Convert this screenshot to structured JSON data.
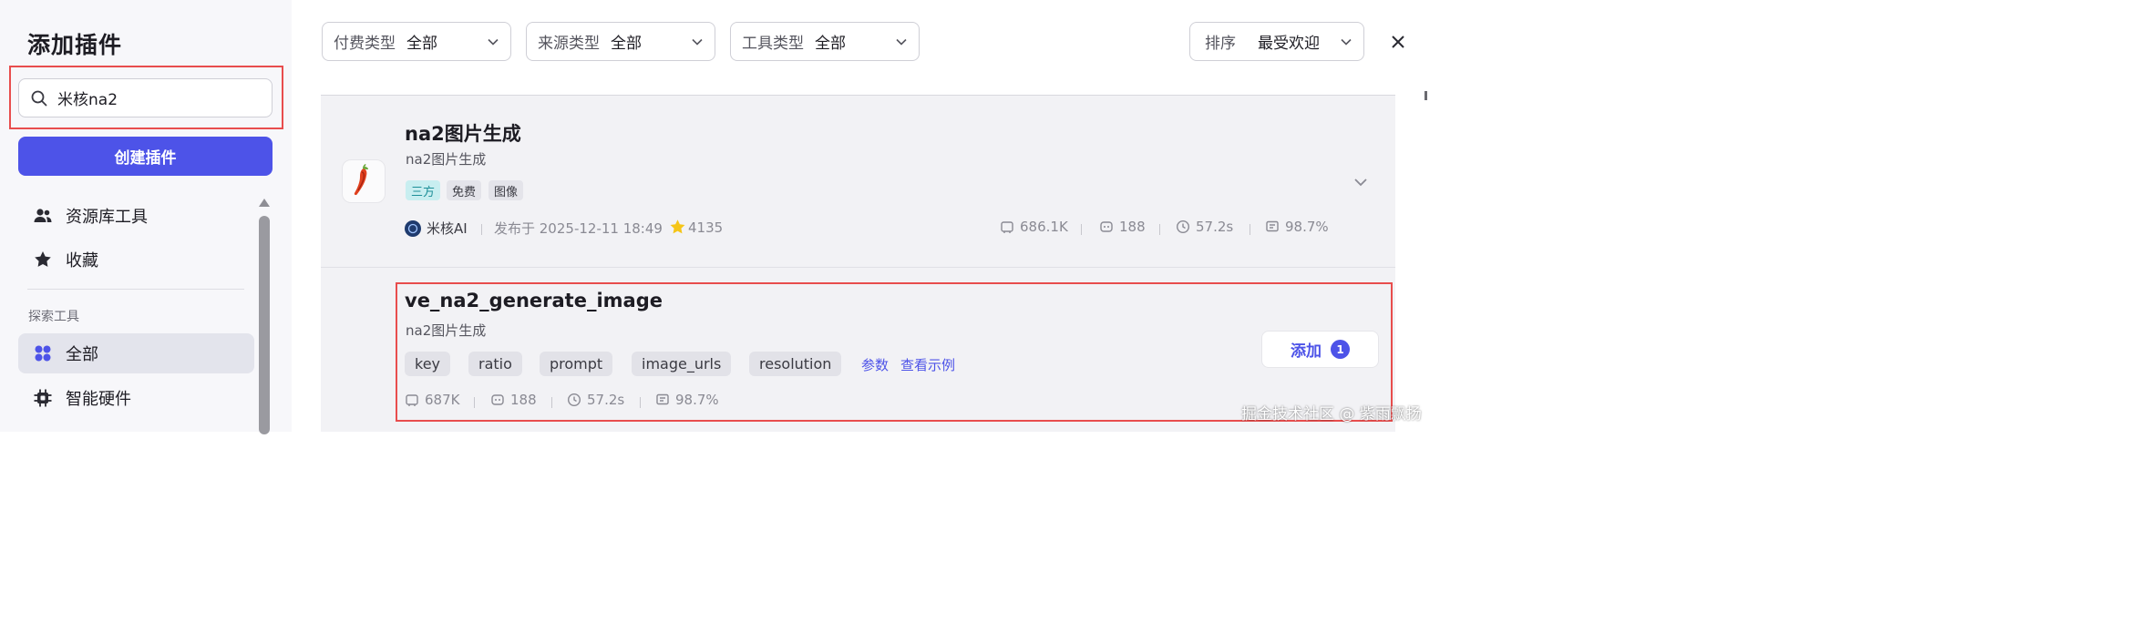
{
  "sidebar": {
    "title": "添加插件",
    "search": {
      "value": "米核na2",
      "placeholder": ""
    },
    "create_label": "创建插件",
    "items": [
      {
        "label": "资源库工具",
        "icon": "users-icon"
      },
      {
        "label": "收藏",
        "icon": "star-icon"
      }
    ],
    "section_label": "探索工具",
    "explore_items": [
      {
        "label": "全部",
        "icon": "grid-icon",
        "active": true
      },
      {
        "label": "智能硬件",
        "icon": "chip-icon"
      }
    ]
  },
  "filters": [
    {
      "label": "付费类型",
      "value": "全部"
    },
    {
      "label": "来源类型",
      "value": "全部"
    },
    {
      "label": "工具类型",
      "value": "全部"
    }
  ],
  "sort": {
    "label": "排序",
    "value": "最受欢迎"
  },
  "plugins": [
    {
      "title": "na2图片生成",
      "description": "na2图片生成",
      "tags": [
        "三方",
        "免费",
        "图像"
      ],
      "author": "米核AI",
      "published": "发布于 2025-12-11 18:49",
      "stars": "4135",
      "stats": {
        "calls": "686.1K",
        "bots": "188",
        "latency": "57.2s",
        "success": "98.7%"
      }
    }
  ],
  "tool": {
    "title": "ve_na2_generate_image",
    "description": "na2图片生成",
    "params": [
      "key",
      "ratio",
      "prompt",
      "image_urls",
      "resolution"
    ],
    "params_link": "参数",
    "example_link": "查看示例",
    "stats": {
      "calls": "687K",
      "bots": "188",
      "latency": "57.2s",
      "success": "98.7%"
    },
    "add_label": "添加",
    "add_count": "1"
  },
  "watermark": "掘金技术社区 @ 紫雨飘扬",
  "colors": {
    "accent": "#4d53e8",
    "highlight": "#e84d4d",
    "third_party_tag": "#c8eef0"
  }
}
